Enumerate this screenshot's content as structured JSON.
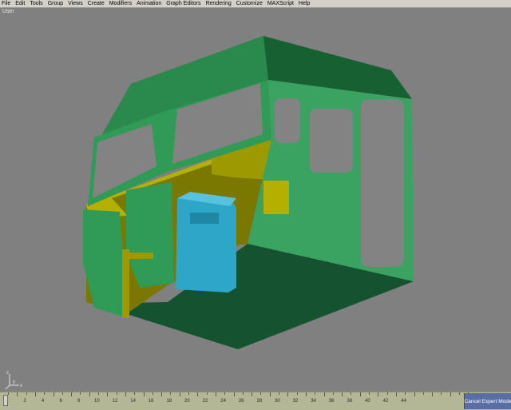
{
  "menu": [
    "File",
    "Edit",
    "Tools",
    "Group",
    "Views",
    "Create",
    "Modifiers",
    "Animation",
    "Graph Editors",
    "Rendering",
    "Customize",
    "MAXScript",
    "Help"
  ],
  "viewport": {
    "label": "User",
    "axis": {
      "x": "x",
      "y": "y",
      "z": "z"
    }
  },
  "timeline": {
    "ticks": [
      "2",
      "4",
      "6",
      "8",
      "10",
      "12",
      "14",
      "16",
      "18",
      "20",
      "22",
      "24",
      "26",
      "28",
      "30",
      "32",
      "34",
      "36",
      "38",
      "40",
      "42",
      "44"
    ],
    "slider_position": 0
  },
  "expert_mode_button": "Cancel Expert Mode",
  "colors": {
    "viewport_bg": "#808080",
    "cab_shell": "#2f9b57",
    "cab_roof_dark": "#176032",
    "floor": "#145230",
    "interior_olive": "#9c9a00",
    "seat_cyan": "#2ea6c7",
    "timeline_bg": "#b3b795",
    "expert_button": "#5a6ea6"
  }
}
